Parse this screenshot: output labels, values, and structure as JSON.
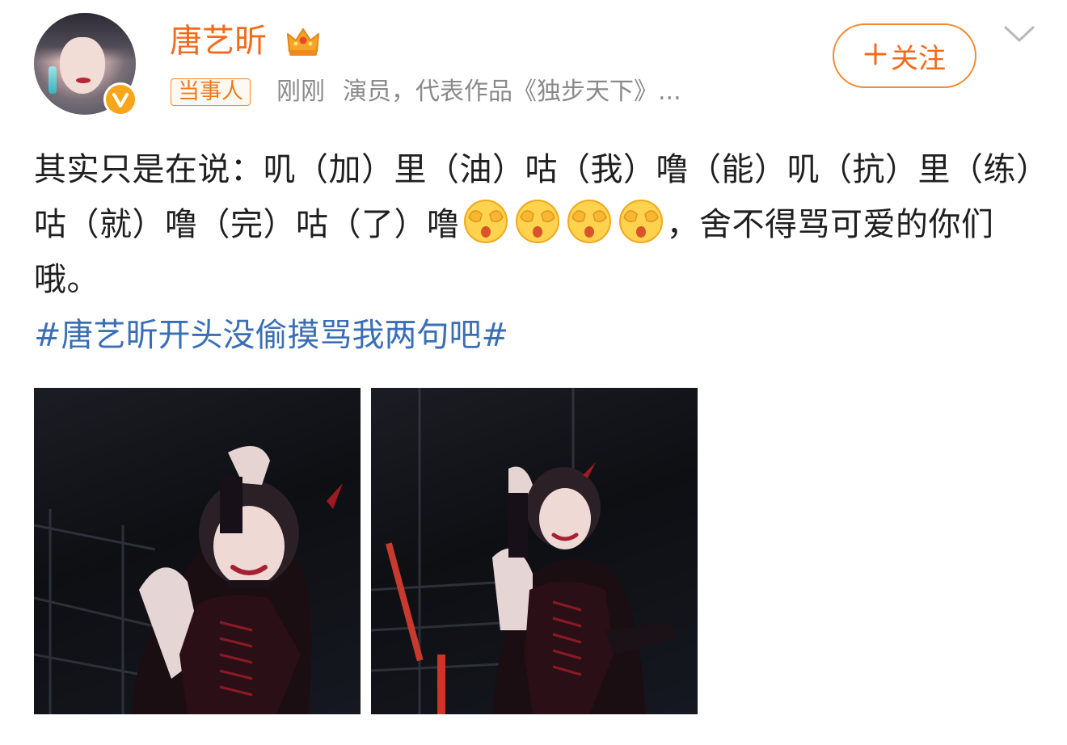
{
  "user": {
    "name": "唐艺昕",
    "tag": "当事人",
    "time": "刚刚",
    "description": "演员，代表作品《独步天下》..."
  },
  "follow_button": {
    "label": "关注"
  },
  "post": {
    "text": "其实只是在说：叽（加）里（油）咕（我）噜（能）叽（抗）里（练）咕（就）噜（完）咕（了）噜",
    "text_after_emojis": "，舍不得骂可爱的你们哦。",
    "emojis": [
      "covering-face-emoji",
      "covering-face-emoji",
      "covering-face-emoji",
      "covering-face-emoji"
    ],
    "hashtag": "#唐艺昕开头没偷摸骂我两句吧#"
  },
  "photos": [
    {
      "icon": "photo-woman-devil-costume-1"
    },
    {
      "icon": "photo-woman-devil-costume-2"
    }
  ],
  "colors": {
    "brand_orange": "#f26b1d",
    "hashtag_blue": "#3a6fb5",
    "meta_gray": "#8a8a8a"
  }
}
